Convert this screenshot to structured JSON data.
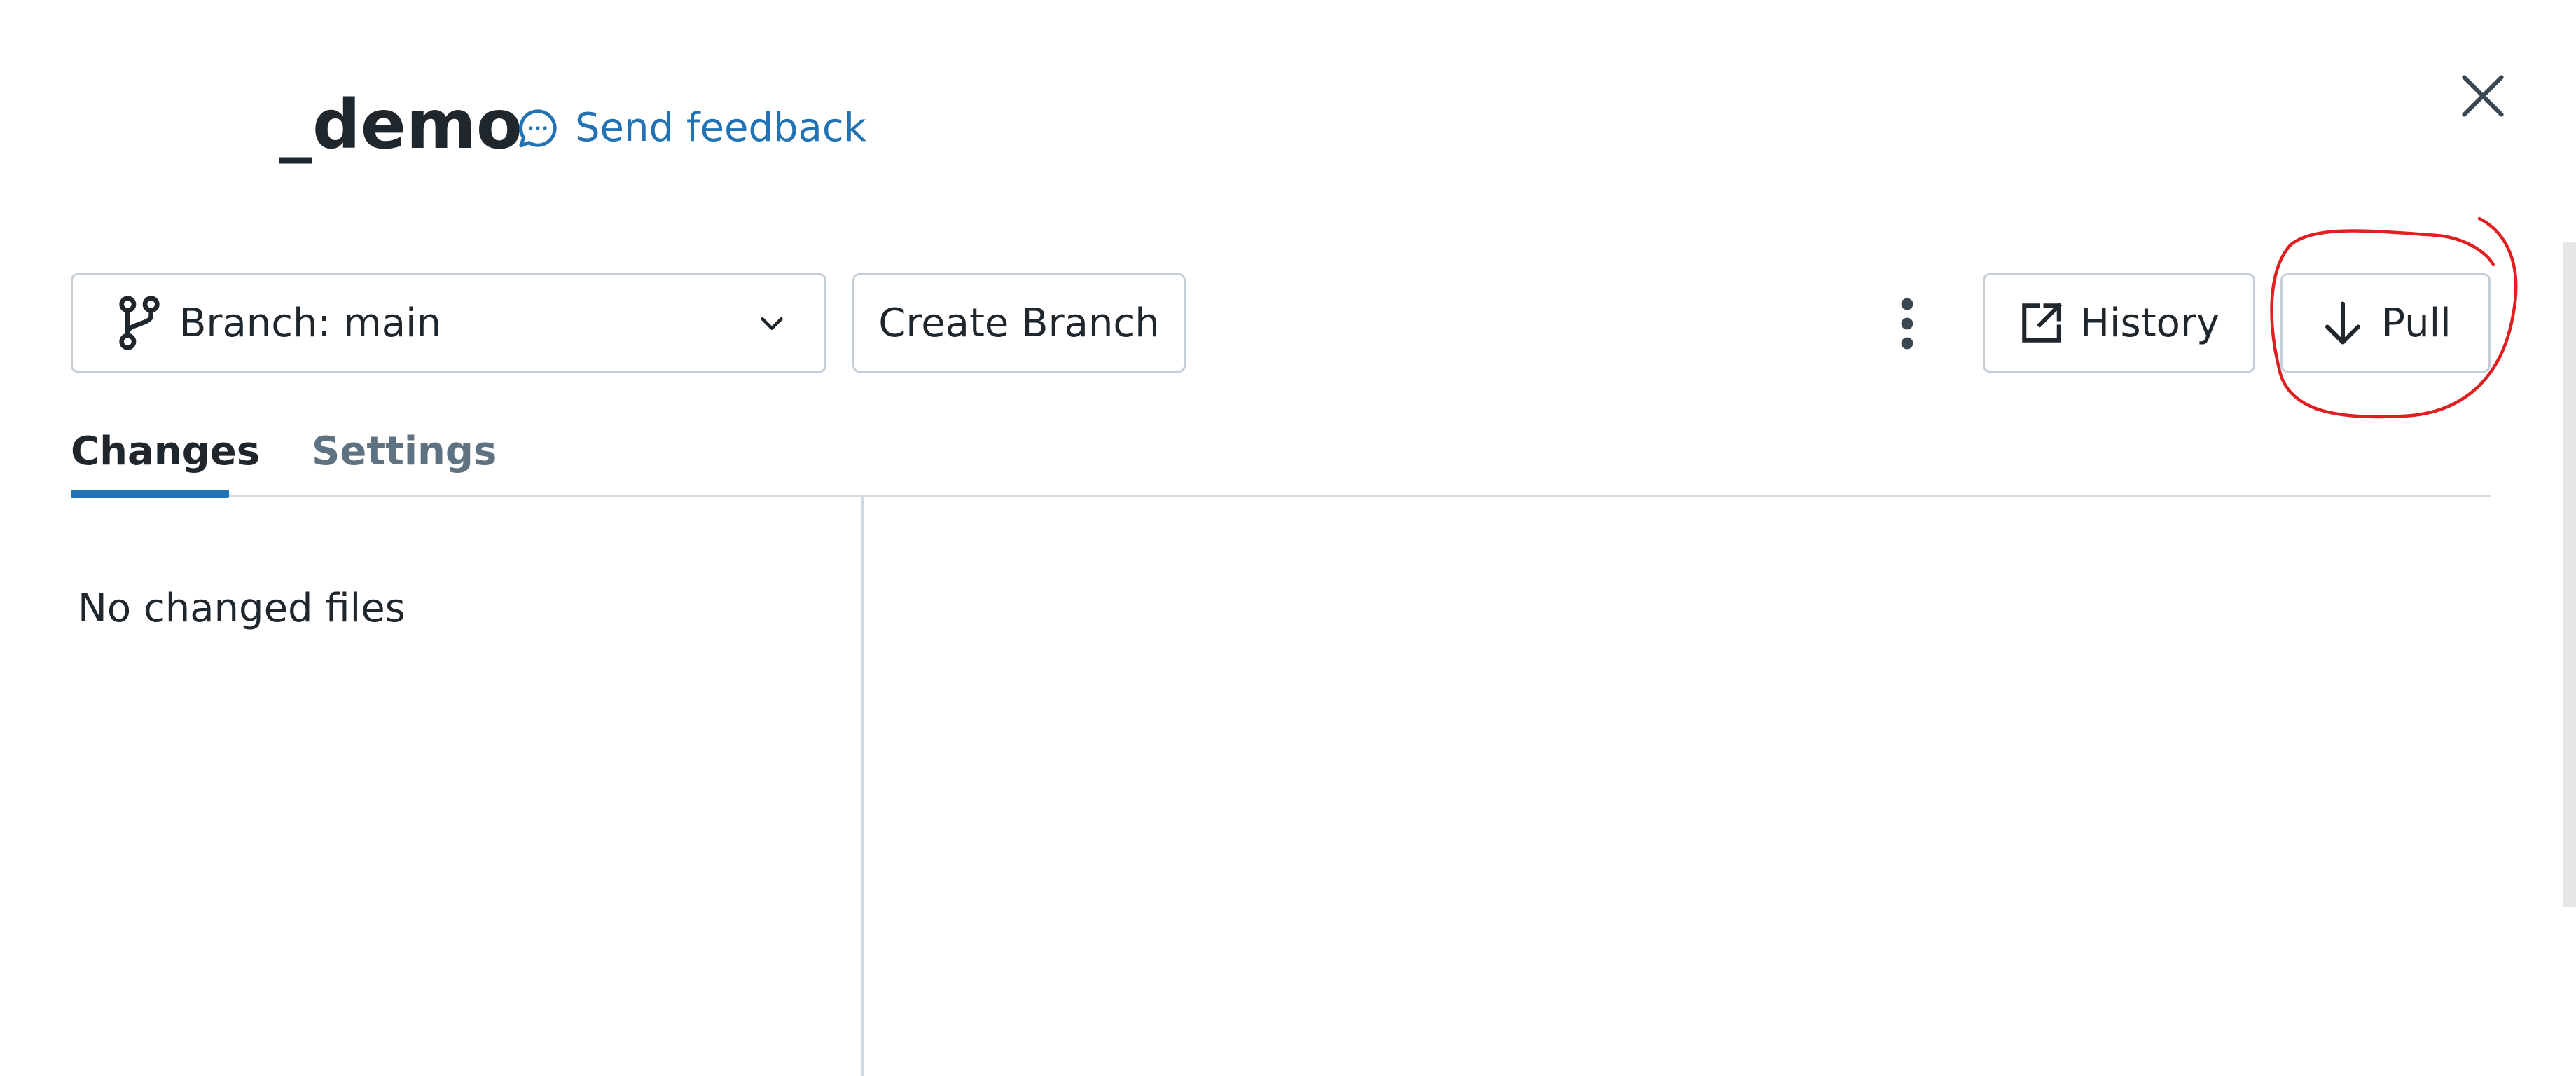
{
  "header": {
    "title": "_demo",
    "feedback_label": "Send feedback",
    "feedback_icon": "chat-bubble-icon",
    "close_icon": "close-icon"
  },
  "toolbar": {
    "branch_label": "Branch: main",
    "branch_icon": "git-branch-icon",
    "branch_chevron_icon": "chevron-down-icon",
    "create_branch_label": "Create Branch",
    "more_icon": "kebab-menu-icon",
    "history_label": "History",
    "history_icon": "external-link-icon",
    "pull_label": "Pull",
    "pull_icon": "arrow-down-icon"
  },
  "tabs": [
    {
      "label": "Changes",
      "active": true
    },
    {
      "label": "Settings",
      "active": false
    }
  ],
  "changes_panel": {
    "empty_message": "No changed files"
  },
  "colors": {
    "accent": "#2272b4",
    "text": "#1f272d",
    "muted": "#5f7281",
    "border": "#c5ced8",
    "annotation": "#e02020"
  }
}
